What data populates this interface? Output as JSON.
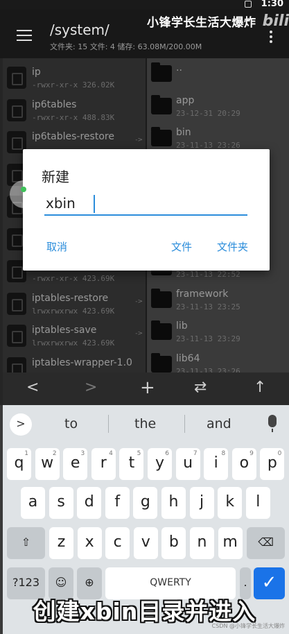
{
  "status": {
    "time": "1:30"
  },
  "watermark": {
    "channel": "小锋学长生活大爆炸",
    "logo": "bili"
  },
  "appbar": {
    "path": "/system/",
    "info": "文件夹: 15  文件: 4  储存: 63.08M/200.00M"
  },
  "left_pane": {
    "items": [
      {
        "name": "ip",
        "meta": "-rwxr-xr-x 326.02K",
        "link": false
      },
      {
        "name": "ip6tables",
        "meta": "-rwxr-xr-x 488.83K",
        "link": false
      },
      {
        "name": "ip6tables-restore",
        "meta": "",
        "link": true
      },
      {
        "name": "",
        "meta": "",
        "link": false
      },
      {
        "name": "",
        "meta": "",
        "link": false
      },
      {
        "name": "",
        "meta": "",
        "link": false
      },
      {
        "name": "",
        "meta": "-rwxr-xr-x 423.69K",
        "link": false
      },
      {
        "name": "iptables-restore",
        "meta": "lrwxrwxrwx 423.69K",
        "link": true
      },
      {
        "name": "iptables-save",
        "meta": "lrwxrwxrwx 423.69K",
        "link": true
      },
      {
        "name": "iptables-wrapper-1.0",
        "meta": "",
        "link": false
      }
    ],
    "link_arrow": "->"
  },
  "right_pane": {
    "items": [
      {
        "name": "..",
        "meta": ""
      },
      {
        "name": "app",
        "meta": "23-12-31 20:29"
      },
      {
        "name": "bin",
        "meta": "23-11-13 23:26"
      },
      {
        "name": "",
        "meta": ""
      },
      {
        "name": "",
        "meta": ""
      },
      {
        "name": "",
        "meta": ""
      },
      {
        "name": "",
        "meta": "23-11-13 22:52"
      },
      {
        "name": "framework",
        "meta": "23-11-13 23:25"
      },
      {
        "name": "lib",
        "meta": "23-11-13 23:29"
      },
      {
        "name": "lib64",
        "meta": "23-11-13 23:26"
      }
    ]
  },
  "dialog": {
    "title": "新建",
    "input_value": "xbin",
    "cancel": "取消",
    "create_file": "文件",
    "create_folder": "文件夹"
  },
  "toolbar": {
    "back": "<",
    "forward": ">",
    "add": "+",
    "swap": "⇄",
    "up": "↑"
  },
  "keyboard": {
    "expand": ">",
    "suggestions": [
      "to",
      "the",
      "and"
    ],
    "row1": [
      {
        "k": "q",
        "s": "1"
      },
      {
        "k": "w",
        "s": "2"
      },
      {
        "k": "e",
        "s": "3"
      },
      {
        "k": "r",
        "s": "4"
      },
      {
        "k": "t",
        "s": "5"
      },
      {
        "k": "y",
        "s": "6"
      },
      {
        "k": "u",
        "s": "7"
      },
      {
        "k": "i",
        "s": "8"
      },
      {
        "k": "o",
        "s": "9"
      },
      {
        "k": "p",
        "s": "0"
      }
    ],
    "row2": [
      "a",
      "s",
      "d",
      "f",
      "g",
      "h",
      "j",
      "k",
      "l"
    ],
    "row3": [
      "z",
      "x",
      "c",
      "v",
      "b",
      "n",
      "m"
    ],
    "shift": "⇧",
    "backspace": "⌫",
    "symbols": "?123",
    "emoji": "☺",
    "globe": "⊕",
    "space": "QWERTY",
    "period": ".",
    "enter": "✓"
  },
  "caption": "创建xbin目录并进入",
  "credit": "CSDN @小锋学长生活大爆炸"
}
